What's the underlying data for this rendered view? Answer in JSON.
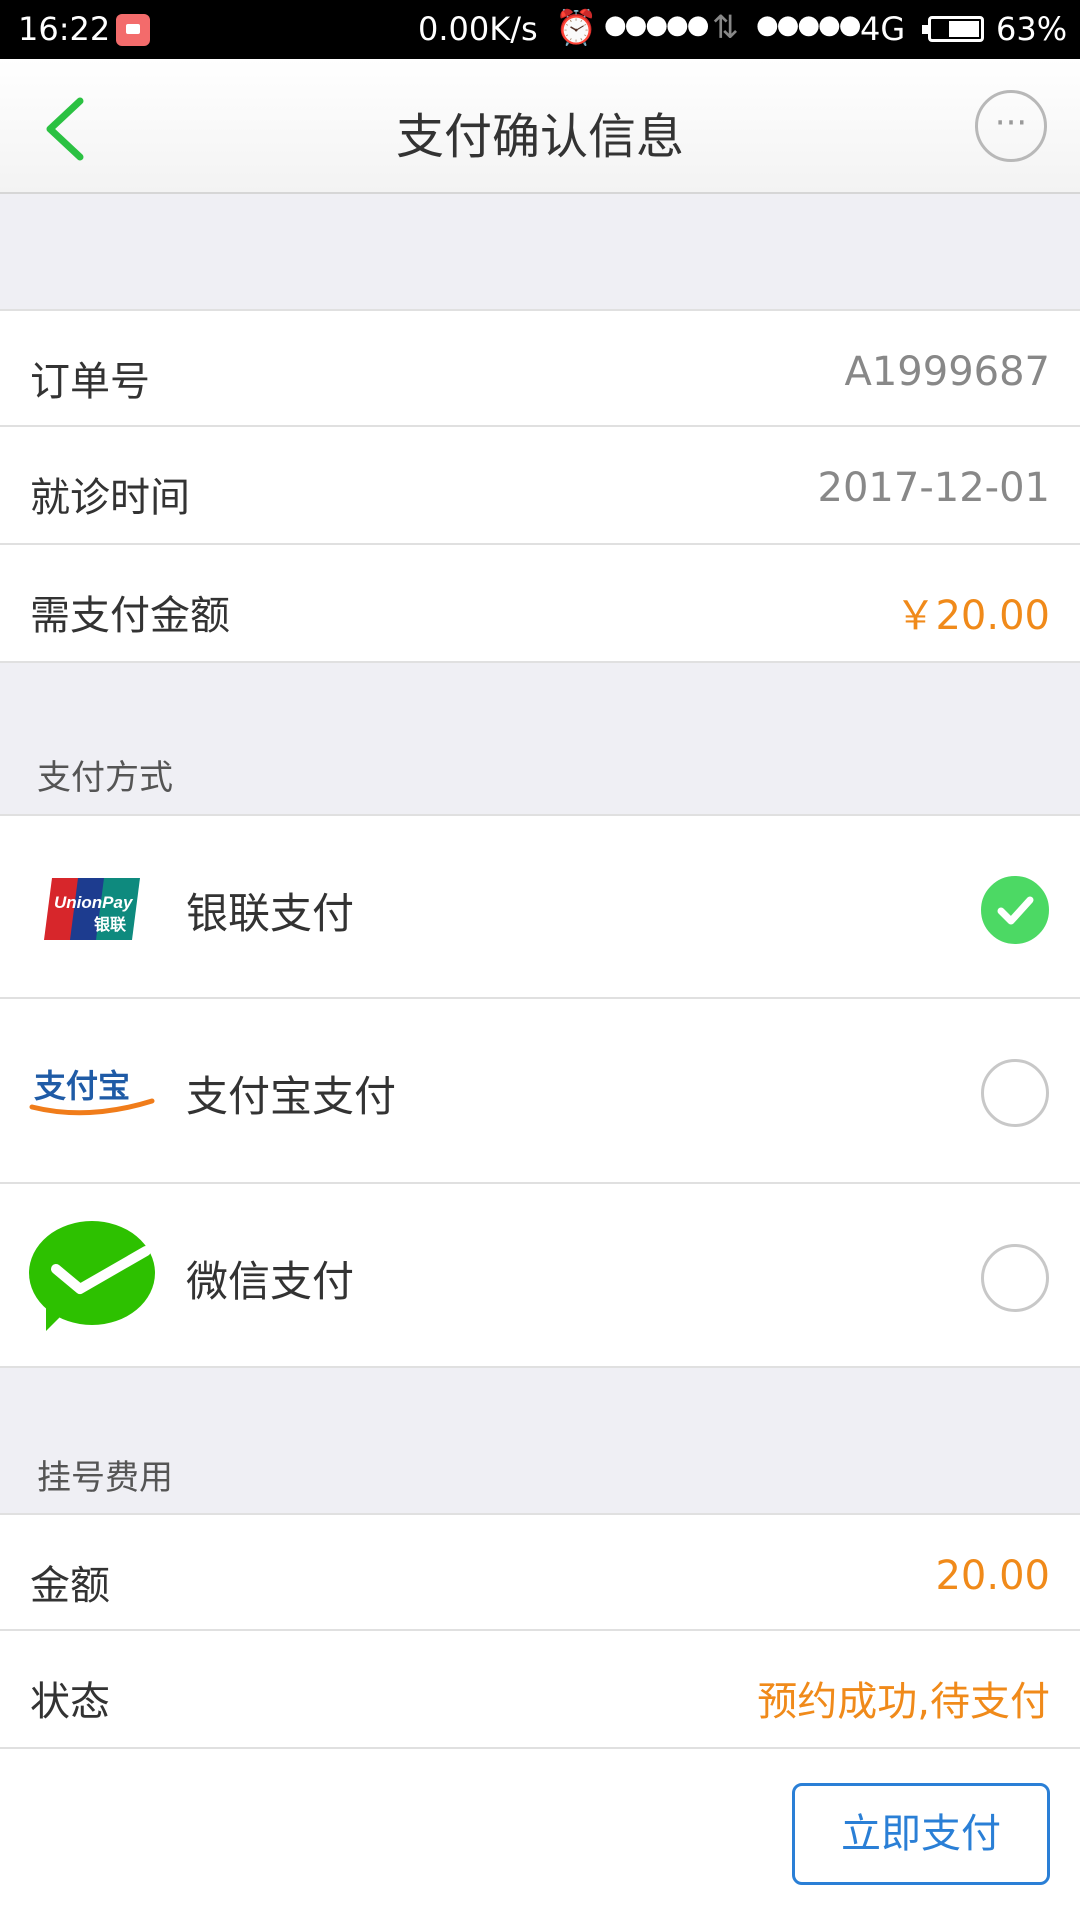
{
  "status_bar": {
    "time": "16:22",
    "speed": "0.00K/s",
    "signal_1": "●●●●●",
    "signal_2": "●●●●●",
    "network": "4G",
    "battery_percent": "63%",
    "battery_level": 0.63
  },
  "nav": {
    "title": "支付确认信息",
    "more_label": "···"
  },
  "order": {
    "order_no_label": "订单号",
    "order_no_value": "A1999687",
    "visit_time_label": "就诊时间",
    "visit_time_value": "2017-12-01",
    "amount_due_label": "需支付金额",
    "amount_due_value": "￥20.00"
  },
  "payment": {
    "section_title": "支付方式",
    "methods": [
      {
        "label": "银联支付",
        "icon": "unionpay-logo",
        "selected": true
      },
      {
        "label": "支付宝支付",
        "icon": "alipay-logo",
        "selected": false
      },
      {
        "label": "微信支付",
        "icon": "wechat-pay-logo",
        "selected": false
      }
    ],
    "unionpay_logo_text": "UnionPay",
    "unionpay_logo_cn": "银联",
    "alipay_logo_text": "支付宝"
  },
  "fee": {
    "section_title": "挂号费用",
    "amount_label": "金额",
    "amount_value": "20.00",
    "status_label": "状态",
    "status_value": "预约成功,待支付"
  },
  "actions": {
    "pay_now": "立即支付"
  },
  "colors": {
    "accent_green": "#4cd964",
    "back_arrow": "#2bc142",
    "orange": "#f08a1a",
    "blue": "#2a7fd6"
  }
}
